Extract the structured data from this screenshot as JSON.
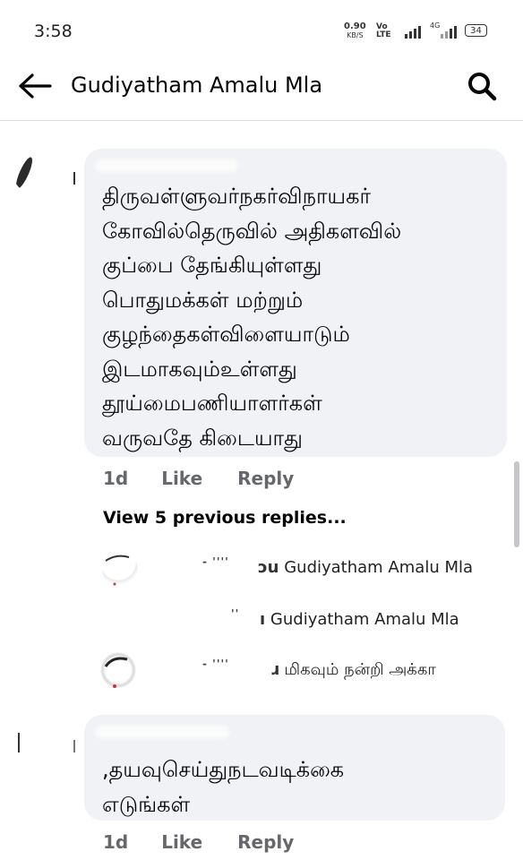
{
  "status_bar": {
    "time": "3:58",
    "net_speed": "0.90",
    "net_speed_unit": "KB/S",
    "volte_top": "Vo",
    "volte_bottom": "LTE",
    "network": "4G",
    "battery": "34"
  },
  "header": {
    "title": "Gudiyatham Amalu Mla"
  },
  "comments": [
    {
      "text": "திருவள்ளுவர்நகர்விநாயகர்\nகோவில்தெருவில் அதிகளவில்\nகுப்பை தேங்கியுள்ளது\nபொதுமக்கள் மற்றும்\nகுழந்தைகள்விளையாடும்\nஇடமாகவும்உள்ளது\nதூய்மைபணியாளர்கள்\nவருவதே கிடையாது",
      "time": "1d",
      "like": "Like",
      "reply": "Reply"
    },
    {
      "text": ",தயவுசெய்துநடவடிக்கை\nஎடுங்கள்",
      "time": "1d",
      "like": "Like",
      "reply": "Reply"
    }
  ],
  "view_previous": "View 5 previous replies...",
  "replies": [
    {
      "name_fragment": "ɔu",
      "snippet": "Gudiyatham Amalu Mla"
    },
    {
      "name_fragment": "ı",
      "snippet": "Gudiyatham Amalu Mla"
    },
    {
      "name_fragment": "ɹ",
      "snippet": "மிகவும் நன்றி அக்கா"
    }
  ],
  "colors": {
    "bubble": "#f0f2f5",
    "meta_text": "#65676b",
    "divider": "#dadde1"
  },
  "icons": [
    "back-arrow-icon",
    "search-icon",
    "signal-icon",
    "battery-icon"
  ]
}
